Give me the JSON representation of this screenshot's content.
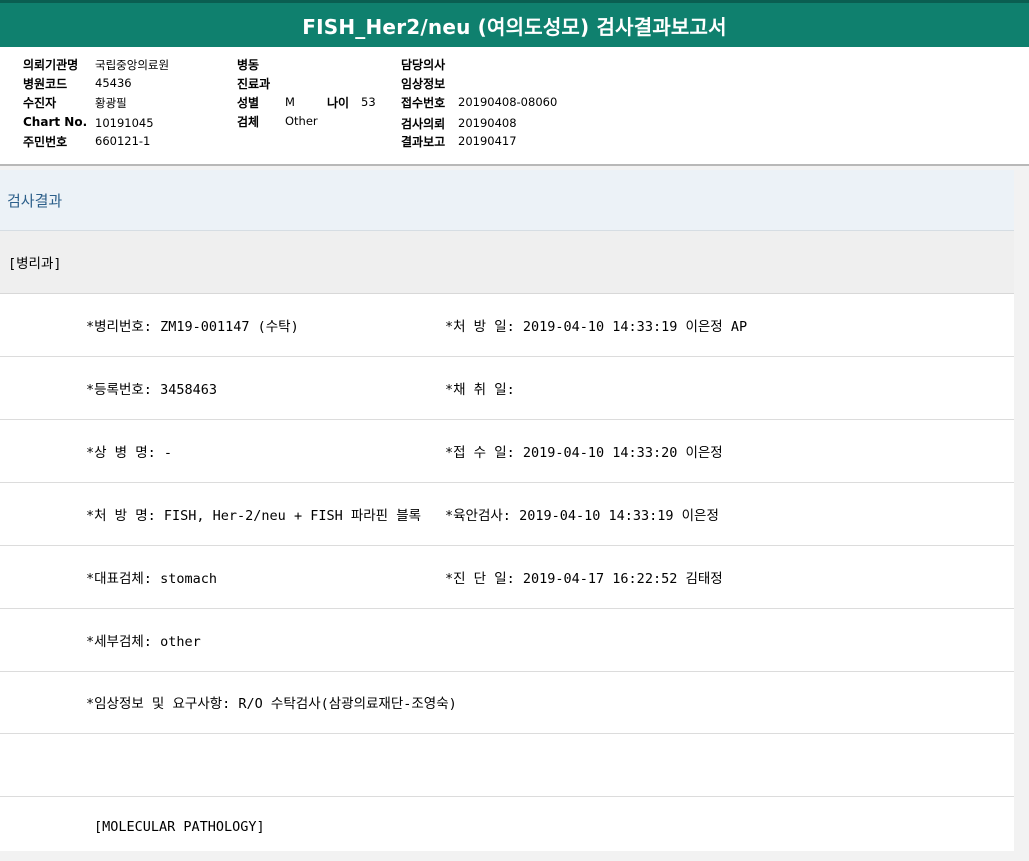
{
  "report": {
    "title": "FISH_Her2/neu (여의도성모) 검사결과보고서"
  },
  "header": {
    "col1": [
      {
        "label": "의뢰기관명",
        "value": "국립중앙의료원"
      },
      {
        "label": "병원코드",
        "value": "45436"
      },
      {
        "label": "수진자",
        "value": "황광필"
      },
      {
        "label": "Chart No.",
        "value": "10191045"
      },
      {
        "label": "주민번호",
        "value": "660121-1"
      }
    ],
    "col2": {
      "ward_label": "병동",
      "dept_label": "진료과",
      "sex_label": "성별",
      "sex_value": "M",
      "age_label": "나이",
      "age_value": "53",
      "specimen_label": "검체",
      "specimen_value": "Other"
    },
    "col3": [
      {
        "label": "담당의사",
        "value": ""
      },
      {
        "label": "임상정보",
        "value": ""
      },
      {
        "label": "접수번호",
        "value": "20190408-08060"
      },
      {
        "label": "검사의뢰",
        "value": "20190408"
      },
      {
        "label": "결과보고",
        "value": "20190417"
      }
    ]
  },
  "results": {
    "section_title": "검사결과",
    "department": "[병리과]",
    "rows": [
      {
        "left": "*병리번호: ZM19-001147 (수탁)",
        "right": "*처 방 일: 2019-04-10 14:33:19  이은정 AP"
      },
      {
        "left": "*등록번호: 3458463",
        "right": "*채 취 일:"
      },
      {
        "left": "*상 병 명: -",
        "right": "*접 수 일: 2019-04-10 14:33:20  이은정"
      },
      {
        "left": "*처 방 명: FISH, Her-2/neu + FISH 파라핀 블록",
        "right": "*육안검사: 2019-04-10 14:33:19  이은정"
      },
      {
        "left": "*대표검체: stomach",
        "right": "*진 단 일: 2019-04-17 16:22:52  김태정"
      },
      {
        "left": "*세부검체: other",
        "right": ""
      },
      {
        "left": "*임상정보 및 요구사항: R/O 수탁검사(삼광의료재단-조영숙)",
        "right": ""
      },
      {
        "left": "",
        "right": ""
      }
    ],
    "molecular_heading": "[MOLECULAR PATHOLOGY]"
  }
}
